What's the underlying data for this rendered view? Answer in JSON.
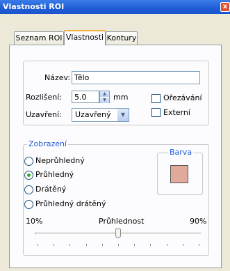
{
  "window": {
    "title": "Vlastnosti ROI",
    "close_glyph": "x"
  },
  "tabs": [
    {
      "label": "Seznam ROI",
      "active": false
    },
    {
      "label": "Vlastnosti",
      "active": true
    },
    {
      "label": "Kontury",
      "active": false
    }
  ],
  "properties": {
    "name_label": "Název:",
    "name_value": "Tělo",
    "resolution_label": "Rozlišení:",
    "resolution_value": "5.0",
    "resolution_unit": "mm",
    "closing_label": "Uzavření:",
    "closing_value": "Uzavřený",
    "clipping_label": "Ořezávání",
    "clipping_checked": false,
    "external_label": "Externí",
    "external_checked": false
  },
  "display": {
    "legend": "Zobrazení",
    "options": [
      {
        "label": "Neprůhledný",
        "selected": false
      },
      {
        "label": "Průhledný",
        "selected": true
      },
      {
        "label": "Drátěný",
        "selected": false
      },
      {
        "label": "Průhledný drátěný",
        "selected": false
      }
    ],
    "color_legend": "Barva",
    "color_value": "#e1aa9b"
  },
  "transparency": {
    "min_label": "10%",
    "label": "Průhlednost",
    "max_label": "90%",
    "value": 0.5
  }
}
